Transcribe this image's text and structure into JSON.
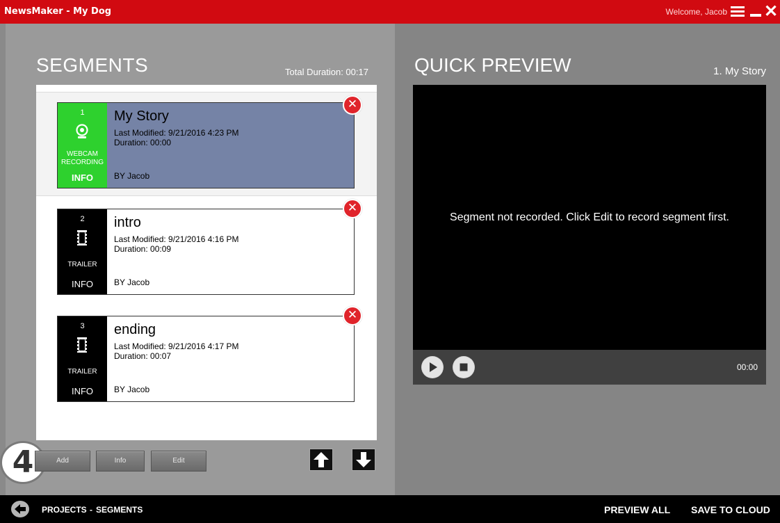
{
  "window": {
    "title": "NewsMaker - My Dog",
    "welcome": "Welcome, Jacob",
    "accent_color": "#d10a11",
    "icons": [
      "hamburger-menu-icon",
      "minimize-icon",
      "close-icon"
    ]
  },
  "segments_panel": {
    "heading": "SEGMENTS",
    "total_duration": "Total Duration: 00:17",
    "items": [
      {
        "number": "1",
        "type_label": "WEBCAM RECORDING",
        "type_icon": "webcam-icon",
        "type_color": "#2ed12e",
        "info_label": "INFO",
        "name": "My Story",
        "last_modified": "Last Modified:  9/21/2016 4:23 PM",
        "duration": "Duration:  00:00",
        "by": "BY  Jacob",
        "selected": true
      },
      {
        "number": "2",
        "type_label": "TRAILER",
        "type_icon": "film-strip-icon",
        "type_color": "#000000",
        "info_label": "INFO",
        "name": "intro",
        "last_modified": "Last Modified:  9/21/2016 4:16 PM",
        "duration": "Duration:  00:09",
        "by": "BY  Jacob",
        "selected": false
      },
      {
        "number": "3",
        "type_label": "TRAILER",
        "type_icon": "film-strip-icon",
        "type_color": "#000000",
        "info_label": "INFO",
        "name": "ending",
        "last_modified": "Last Modified:  9/21/2016 4:17 PM",
        "duration": "Duration:  00:07",
        "by": "BY  Jacob",
        "selected": false
      }
    ],
    "step_badge": "4",
    "buttons": {
      "add": "Add",
      "info": "Info",
      "edit": "Edit"
    },
    "move_icons": [
      "arrow-up-icon",
      "arrow-down-icon"
    ]
  },
  "preview_panel": {
    "heading": "QUICK PREVIEW",
    "current": "1. My Story",
    "message": "Segment not recorded. Click Edit to record segment first.",
    "time": "00:00",
    "controls": [
      "play-icon",
      "stop-icon"
    ]
  },
  "footer": {
    "crumb_projects": "PROJECTS",
    "crumb_separator": "-",
    "crumb_segments": "SEGMENTS",
    "preview_all": "PREVIEW ALL",
    "save_to_cloud": "SAVE TO CLOUD",
    "back_icon": "back-arrow-icon"
  }
}
